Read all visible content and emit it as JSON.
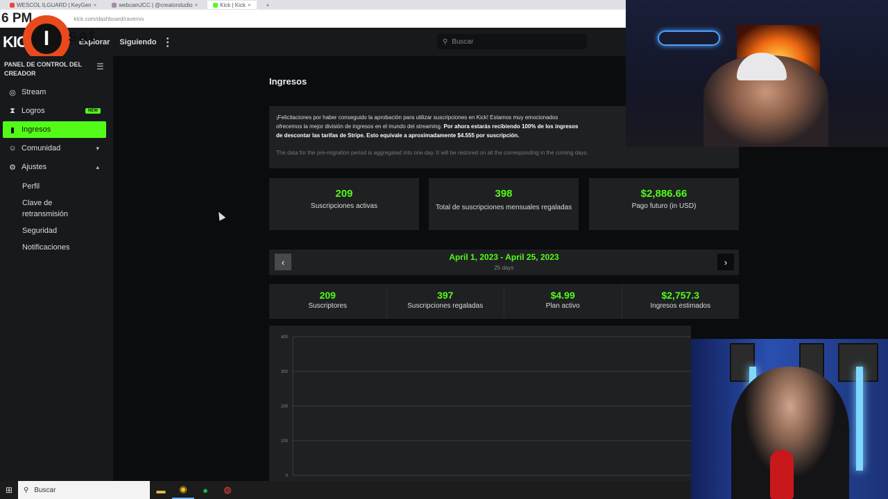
{
  "browser": {
    "tabs": [
      {
        "label": "WESCOL ILGUARD | KeyGen",
        "active": false
      },
      {
        "label": "webcamJCC | @creatorstudio",
        "active": false
      },
      {
        "label": "Kick | Kick",
        "active": true
      }
    ],
    "clock": "6 PM",
    "url": "kick.com/dashboard/ravenvv"
  },
  "watermark": {
    "letter": "I",
    "text": "sat"
  },
  "header": {
    "logo": "KICK",
    "nav_explore": "Explorar",
    "nav_following": "Siguiendo",
    "search_placeholder": "Buscar"
  },
  "sidebar": {
    "title": "PANEL DE CONTROL DEL CREADOR",
    "items": [
      {
        "label": "Stream",
        "icon": "broadcast-icon"
      },
      {
        "label": "Logros",
        "icon": "trophy-icon",
        "badge": "NEW"
      },
      {
        "label": "Ingresos",
        "icon": "bar-chart-icon",
        "active": true
      },
      {
        "label": "Comunidad",
        "icon": "users-icon",
        "chevron": "down"
      },
      {
        "label": "Ajustes",
        "icon": "gear-icon",
        "chevron": "up"
      }
    ],
    "sub_items": [
      "Perfil",
      "Clave de retransmisión",
      "Seguridad",
      "Notificaciones"
    ]
  },
  "main": {
    "title": "Ingresos",
    "notice": {
      "line1": "¡Felicitaciones por haber conseguido la aprobación para utilizar suscripciones en Kick! Estamos muy emocionados",
      "line2": "ofrecemos la mejor división de ingresos en el mundo del streaming.",
      "bold": "Por ahora estarás recibiendo 100% de los ingresos",
      "line3": "de descontar las tarifas de Stripe. Esto equivale a aproximadamente $4.555 por suscripción.",
      "subtext": "The data for the pre-migration period is aggregated into one day. It will be restored on all the corresponding in the coming days."
    },
    "cards": [
      {
        "value": "209",
        "label": "Suscripciones activas"
      },
      {
        "value": "398",
        "label": "Total de suscripciones mensuales regaladas"
      },
      {
        "value": "$2,886.66",
        "label": "Pago futuro (in USD)"
      }
    ],
    "range": {
      "dates": "April 1, 2023 - April 25, 2023",
      "days": "25 days"
    },
    "stats": [
      {
        "value": "209",
        "label": "Suscriptores"
      },
      {
        "value": "397",
        "label": "Suscripciones regaladas"
      },
      {
        "value": "$4.99",
        "label": "Plan activo"
      },
      {
        "value": "$2,757.3",
        "label": "Ingresos estimados"
      }
    ]
  },
  "chart_data": {
    "type": "line",
    "title": "",
    "xlabel": "",
    "ylabel": "",
    "ylim": [
      0,
      400
    ],
    "yticks": [
      "400",
      "300",
      "200",
      "100",
      "0"
    ],
    "series": [],
    "grid": true
  },
  "taskbar": {
    "search": "Buscar"
  }
}
